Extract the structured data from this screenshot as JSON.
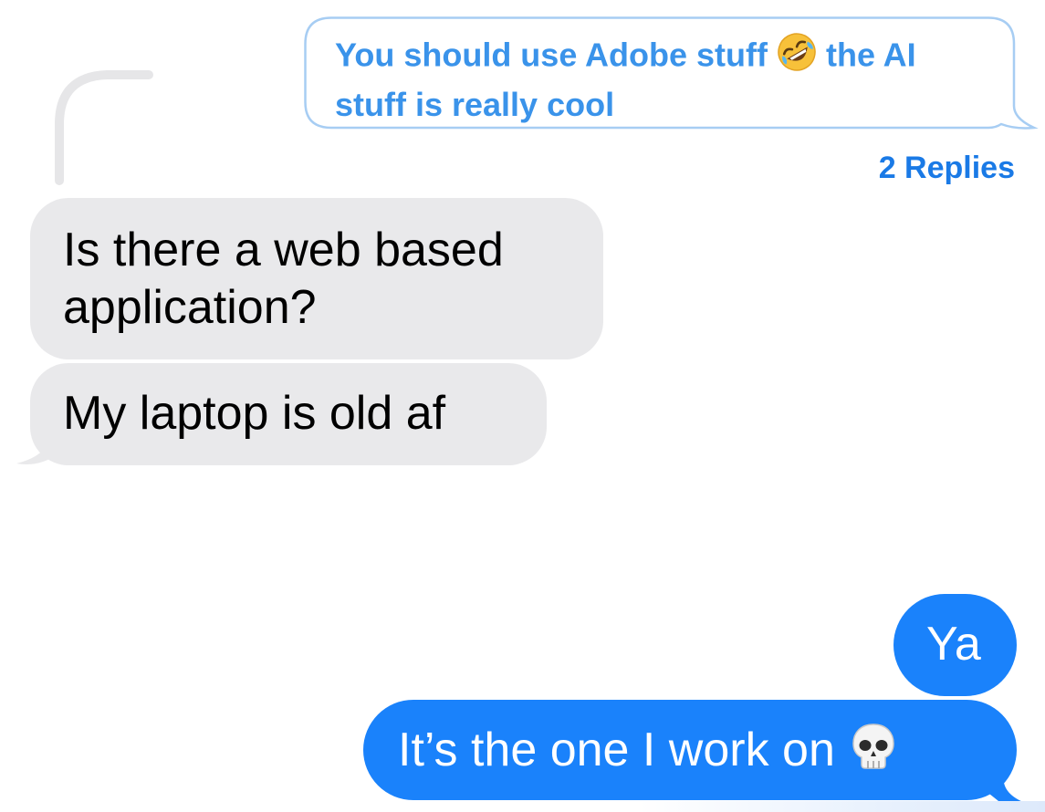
{
  "colors": {
    "outgoing_bubble": "#1a82fb",
    "incoming_bubble": "#e9e9eb",
    "link_blue": "#1a7ae6",
    "quoted_text": "#3a93ea"
  },
  "thread": {
    "quoted_message": {
      "part1": "You should use Adobe stuff ",
      "emoji_icon": "rolling-on-floor-laughing-emoji",
      "part2": " the AI stuff is really cool"
    },
    "replies_label": "2 Replies"
  },
  "messages": [
    {
      "direction": "incoming",
      "text": "Is there a web based application?"
    },
    {
      "direction": "incoming",
      "text": "My laptop is old af"
    },
    {
      "direction": "outgoing",
      "text": "Ya"
    },
    {
      "direction": "outgoing",
      "text": "It’s the one I work on ",
      "emoji_icon": "skull-emoji"
    }
  ]
}
